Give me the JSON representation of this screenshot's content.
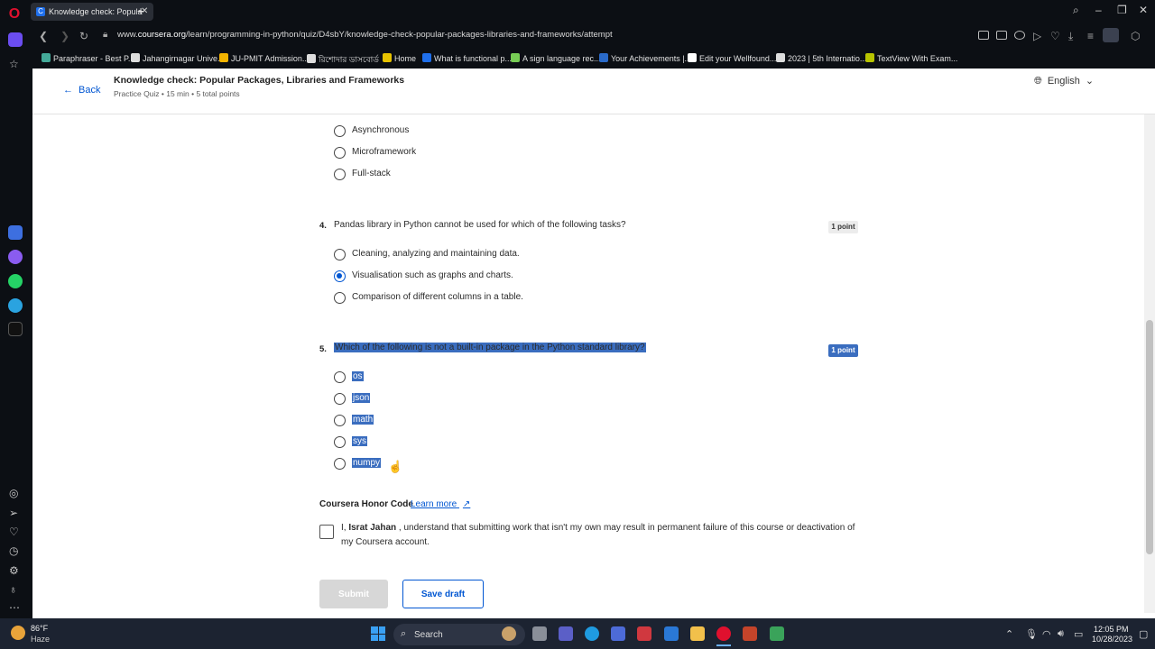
{
  "browser": {
    "tab_title": "Knowledge check: Popula",
    "url_prefix": "www.",
    "url_host": "coursera.org",
    "url_path": "/learn/programming-in-python/quiz/D4sbY/knowledge-check-popular-packages-libraries-and-frameworks/attempt",
    "bookmarks": [
      "Paraphraser - Best P...",
      "Jahangirnagar Unive...",
      "JU-PMIT Admission...",
      "রিশোদার ডাসবোর্ড",
      "Home",
      "What is functional p...",
      "A sign language rec...",
      "Your Achievements |...",
      "Edit your Wellfound...",
      "2023 | 5th Internatio...",
      "TextView With Exam..."
    ]
  },
  "header": {
    "back_label": "Back",
    "quiz_title": "Knowledge check: Popular Packages, Libraries and Frameworks",
    "quiz_meta": "Practice Quiz • 15 min • 5 total points",
    "language": "English"
  },
  "question3": {
    "options": [
      "Asynchronous",
      "Microframework",
      "Full-stack"
    ]
  },
  "question4": {
    "number": "4.",
    "text": "Pandas library in Python cannot be used for which of the following tasks?",
    "points": "1 point",
    "options": [
      "Cleaning, analyzing and maintaining data.",
      "Visualisation such as graphs and charts.",
      "Comparison of different columns in a table."
    ],
    "selected_index": 1
  },
  "question5": {
    "number": "5.",
    "text": "Which of the following is not a built-in package in the Python standard library?",
    "points": "1 point",
    "options": [
      "os",
      "json",
      "math",
      "sys",
      "numpy"
    ]
  },
  "honor": {
    "title": "Coursera Honor Code",
    "learn_more": "Learn more",
    "text_prefix": "I, ",
    "name": "Israt Jahan",
    "text_suffix": " , understand that submitting work that isn't my own may result in permanent failure of this course or deactivation of my Coursera account."
  },
  "actions": {
    "submit_label": "Submit",
    "save_draft_label": "Save draft"
  },
  "taskbar": {
    "weather_temp": "86°F",
    "weather_desc": "Haze",
    "search_label": "Search",
    "time": "12:05 PM",
    "date": "10/28/2023"
  }
}
